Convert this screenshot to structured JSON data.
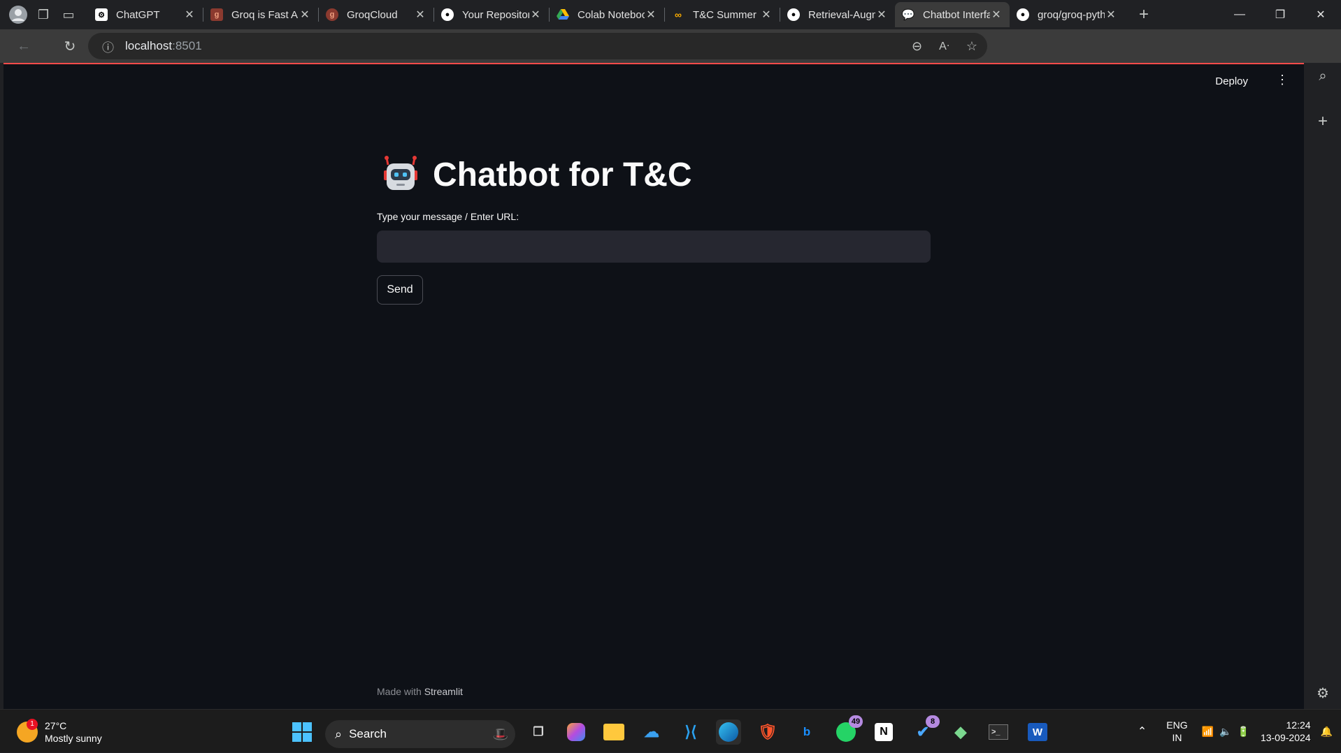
{
  "browser": {
    "tabs": [
      {
        "title": "ChatGPT",
        "icon": "chatgpt-icon"
      },
      {
        "title": "Groq is Fast AI",
        "icon": "groq-icon"
      },
      {
        "title": "GroqCloud",
        "icon": "groq-icon"
      },
      {
        "title": "Your Repositories",
        "icon": "github-icon"
      },
      {
        "title": "Colab Notebooks",
        "icon": "drive-icon"
      },
      {
        "title": "T&C Summer",
        "icon": "colab-icon"
      },
      {
        "title": "Retrieval-Augmented",
        "icon": "github-icon"
      },
      {
        "title": "Chatbot Interface",
        "icon": "chat-icon",
        "active": true
      },
      {
        "title": "groq/groq-python",
        "icon": "github-icon"
      }
    ],
    "url_host": "localhost",
    "url_port": ":8501"
  },
  "app": {
    "deploy_label": "Deploy",
    "title": "Chatbot for T&C",
    "input_label": "Type your message / Enter URL:",
    "input_value": "",
    "send_label": "Send",
    "footer_prefix": "Made with",
    "footer_brand": "Streamlit"
  },
  "taskbar": {
    "weather_temp": "27°C",
    "weather_desc": "Mostly sunny",
    "weather_badge": "1",
    "search_label": "Search",
    "whatsapp_badge": "49",
    "vscode_badge": "8",
    "lang_top": "ENG",
    "lang_bottom": "IN",
    "time": "12:24",
    "date": "13-09-2024"
  }
}
